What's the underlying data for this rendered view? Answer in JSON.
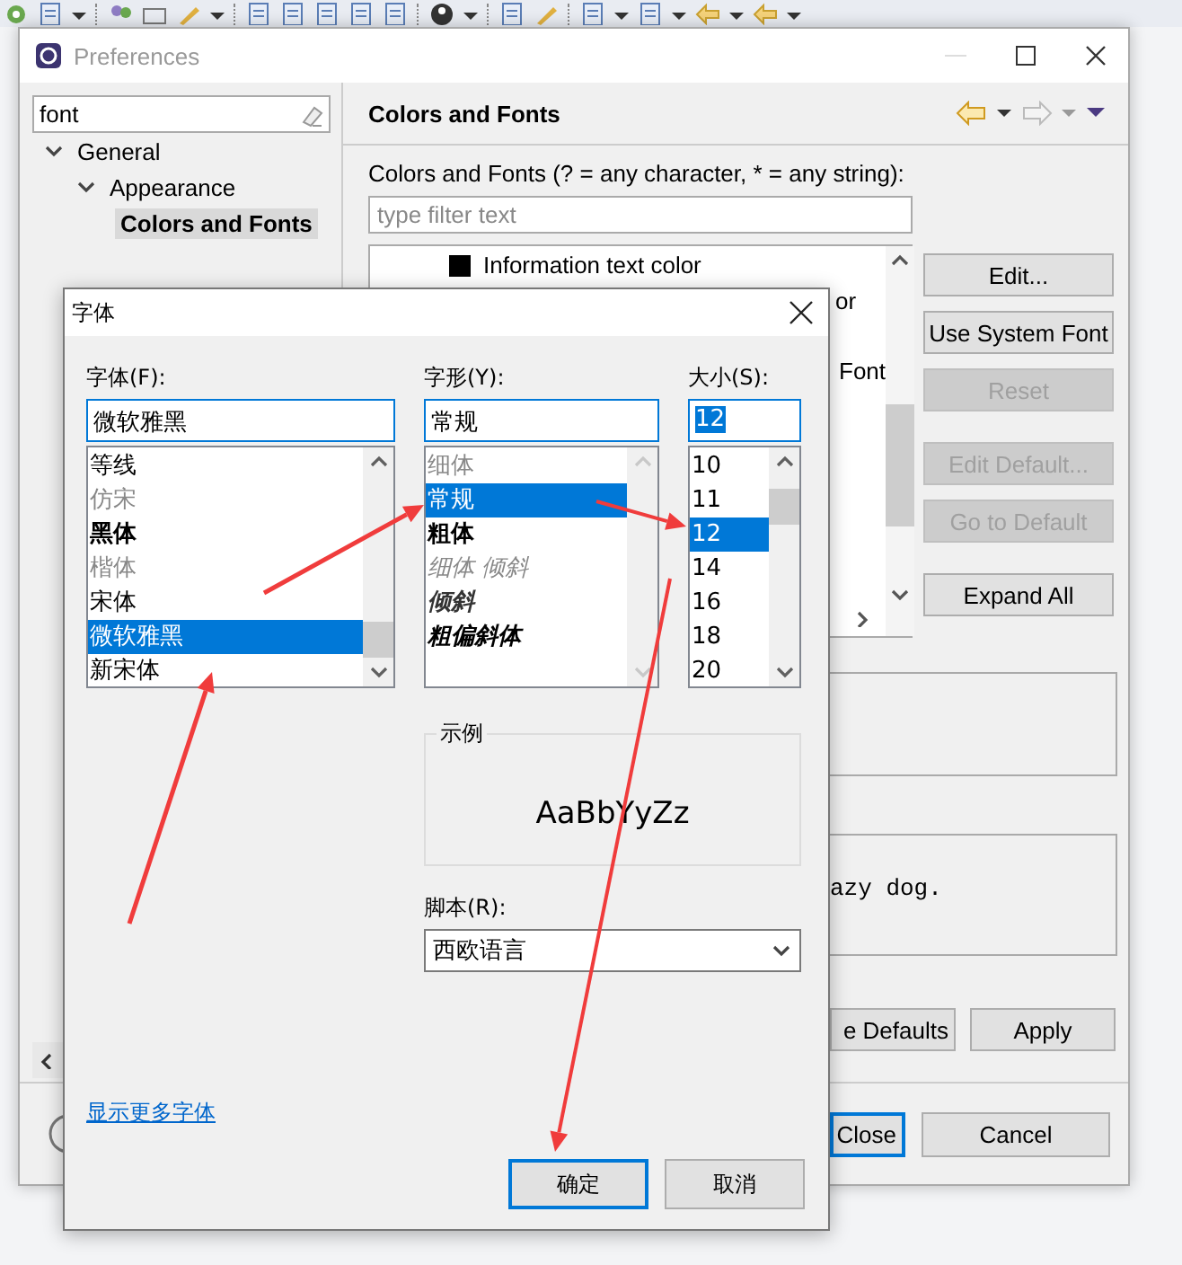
{
  "preferences": {
    "title": "Preferences",
    "search": {
      "value": "font"
    },
    "tree": [
      {
        "label": "General",
        "expanded": true,
        "selected": false,
        "children": [
          {
            "label": "Appearance",
            "expanded": true,
            "selected": false,
            "children": [
              {
                "label": "Colors and Fonts",
                "selected": true
              }
            ]
          }
        ]
      }
    ],
    "page_title": "Colors and Fonts",
    "filter_label": "Colors and Fonts (? = any character, * = any string):",
    "filter": {
      "placeholder": "type filter text"
    },
    "items": [
      {
        "kind": "color",
        "label": "Information text color",
        "color": "#000000"
      },
      {
        "kind": "clipped",
        "label": "or"
      },
      {
        "kind": "clipped",
        "label": "Font"
      }
    ],
    "side_buttons": [
      {
        "label": "Edit...",
        "disabled": false
      },
      {
        "label": "Use System Font",
        "disabled": false
      },
      {
        "label": "Reset",
        "disabled": true
      },
      {
        "label": "Edit Default...",
        "disabled": true
      },
      {
        "label": "Go to Default",
        "disabled": true
      },
      {
        "label": "Expand All",
        "disabled": false
      }
    ],
    "preview": "azy dog.",
    "action_buttons": [
      {
        "label": "e Defaults",
        "default": false
      },
      {
        "label": "Apply",
        "default": false
      }
    ],
    "footer_buttons": [
      {
        "label": "Close",
        "default": true
      },
      {
        "label": "Cancel",
        "default": false
      }
    ]
  },
  "font_dialog": {
    "title": "字体",
    "columns": [
      {
        "label": "字体(F):",
        "value": "微软雅黑",
        "highlighted": false,
        "options": [
          {
            "label": "等线",
            "selected": false,
            "kind": "regular"
          },
          {
            "label": "仿宋",
            "selected": false,
            "kind": "dim"
          },
          {
            "label": "黑体",
            "selected": false,
            "kind": "bold"
          },
          {
            "label": "楷体",
            "selected": false,
            "kind": "dim"
          },
          {
            "label": "宋体",
            "selected": false,
            "kind": "regular"
          },
          {
            "label": "微软雅黑",
            "selected": true,
            "kind": "regular"
          },
          {
            "label": "新宋体",
            "selected": false,
            "kind": "regular"
          }
        ]
      },
      {
        "label": "字形(Y):",
        "value": "常规",
        "highlighted": false,
        "options": [
          {
            "label": "细体",
            "selected": false,
            "kind": "light"
          },
          {
            "label": "常规",
            "selected": true,
            "kind": "regular"
          },
          {
            "label": "粗体",
            "selected": false,
            "kind": "bold"
          },
          {
            "label": "细体 倾斜",
            "selected": false,
            "kind": "lightitalic"
          },
          {
            "label": "倾斜",
            "selected": false,
            "kind": "italic"
          },
          {
            "label": "粗偏斜体",
            "selected": false,
            "kind": "bolditalic"
          }
        ]
      },
      {
        "label": "大小(S):",
        "value": "12",
        "highlighted": true,
        "options": [
          {
            "label": "10",
            "selected": false,
            "kind": "regular"
          },
          {
            "label": "11",
            "selected": false,
            "kind": "regular"
          },
          {
            "label": "12",
            "selected": true,
            "kind": "regular"
          },
          {
            "label": "14",
            "selected": false,
            "kind": "regular"
          },
          {
            "label": "16",
            "selected": false,
            "kind": "regular"
          },
          {
            "label": "18",
            "selected": false,
            "kind": "regular"
          },
          {
            "label": "20",
            "selected": false,
            "kind": "regular"
          }
        ]
      }
    ],
    "sample": {
      "label": "示例",
      "text": "AaBbYyZz"
    },
    "script": {
      "label": "脚本(R):",
      "value": "西欧语言"
    },
    "more_link": "显示更多字体",
    "buttons": [
      {
        "label": "确定",
        "default": true
      },
      {
        "label": "取消",
        "default": false
      }
    ]
  }
}
